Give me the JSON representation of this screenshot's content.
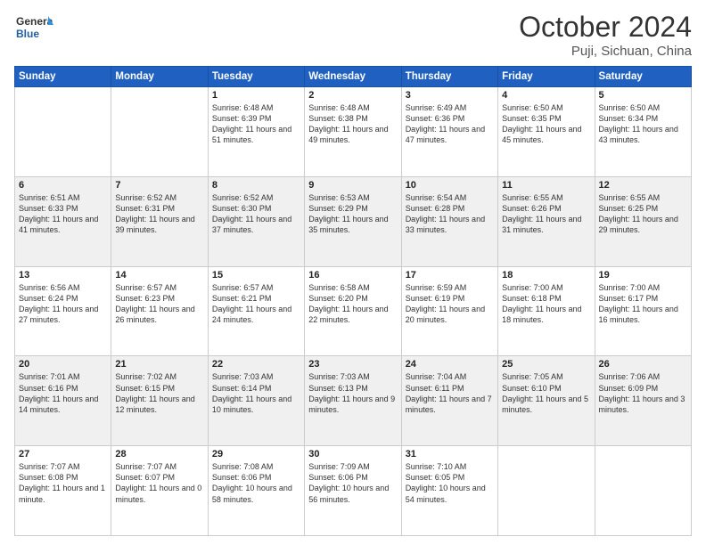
{
  "header": {
    "logo_general": "General",
    "logo_blue": "Blue",
    "month": "October 2024",
    "location": "Puji, Sichuan, China"
  },
  "weekdays": [
    "Sunday",
    "Monday",
    "Tuesday",
    "Wednesday",
    "Thursday",
    "Friday",
    "Saturday"
  ],
  "weeks": [
    [
      {
        "day": "",
        "sunrise": "",
        "sunset": "",
        "daylight": ""
      },
      {
        "day": "",
        "sunrise": "",
        "sunset": "",
        "daylight": ""
      },
      {
        "day": "1",
        "sunrise": "Sunrise: 6:48 AM",
        "sunset": "Sunset: 6:39 PM",
        "daylight": "Daylight: 11 hours and 51 minutes."
      },
      {
        "day": "2",
        "sunrise": "Sunrise: 6:48 AM",
        "sunset": "Sunset: 6:38 PM",
        "daylight": "Daylight: 11 hours and 49 minutes."
      },
      {
        "day": "3",
        "sunrise": "Sunrise: 6:49 AM",
        "sunset": "Sunset: 6:36 PM",
        "daylight": "Daylight: 11 hours and 47 minutes."
      },
      {
        "day": "4",
        "sunrise": "Sunrise: 6:50 AM",
        "sunset": "Sunset: 6:35 PM",
        "daylight": "Daylight: 11 hours and 45 minutes."
      },
      {
        "day": "5",
        "sunrise": "Sunrise: 6:50 AM",
        "sunset": "Sunset: 6:34 PM",
        "daylight": "Daylight: 11 hours and 43 minutes."
      }
    ],
    [
      {
        "day": "6",
        "sunrise": "Sunrise: 6:51 AM",
        "sunset": "Sunset: 6:33 PM",
        "daylight": "Daylight: 11 hours and 41 minutes."
      },
      {
        "day": "7",
        "sunrise": "Sunrise: 6:52 AM",
        "sunset": "Sunset: 6:31 PM",
        "daylight": "Daylight: 11 hours and 39 minutes."
      },
      {
        "day": "8",
        "sunrise": "Sunrise: 6:52 AM",
        "sunset": "Sunset: 6:30 PM",
        "daylight": "Daylight: 11 hours and 37 minutes."
      },
      {
        "day": "9",
        "sunrise": "Sunrise: 6:53 AM",
        "sunset": "Sunset: 6:29 PM",
        "daylight": "Daylight: 11 hours and 35 minutes."
      },
      {
        "day": "10",
        "sunrise": "Sunrise: 6:54 AM",
        "sunset": "Sunset: 6:28 PM",
        "daylight": "Daylight: 11 hours and 33 minutes."
      },
      {
        "day": "11",
        "sunrise": "Sunrise: 6:55 AM",
        "sunset": "Sunset: 6:26 PM",
        "daylight": "Daylight: 11 hours and 31 minutes."
      },
      {
        "day": "12",
        "sunrise": "Sunrise: 6:55 AM",
        "sunset": "Sunset: 6:25 PM",
        "daylight": "Daylight: 11 hours and 29 minutes."
      }
    ],
    [
      {
        "day": "13",
        "sunrise": "Sunrise: 6:56 AM",
        "sunset": "Sunset: 6:24 PM",
        "daylight": "Daylight: 11 hours and 27 minutes."
      },
      {
        "day": "14",
        "sunrise": "Sunrise: 6:57 AM",
        "sunset": "Sunset: 6:23 PM",
        "daylight": "Daylight: 11 hours and 26 minutes."
      },
      {
        "day": "15",
        "sunrise": "Sunrise: 6:57 AM",
        "sunset": "Sunset: 6:21 PM",
        "daylight": "Daylight: 11 hours and 24 minutes."
      },
      {
        "day": "16",
        "sunrise": "Sunrise: 6:58 AM",
        "sunset": "Sunset: 6:20 PM",
        "daylight": "Daylight: 11 hours and 22 minutes."
      },
      {
        "day": "17",
        "sunrise": "Sunrise: 6:59 AM",
        "sunset": "Sunset: 6:19 PM",
        "daylight": "Daylight: 11 hours and 20 minutes."
      },
      {
        "day": "18",
        "sunrise": "Sunrise: 7:00 AM",
        "sunset": "Sunset: 6:18 PM",
        "daylight": "Daylight: 11 hours and 18 minutes."
      },
      {
        "day": "19",
        "sunrise": "Sunrise: 7:00 AM",
        "sunset": "Sunset: 6:17 PM",
        "daylight": "Daylight: 11 hours and 16 minutes."
      }
    ],
    [
      {
        "day": "20",
        "sunrise": "Sunrise: 7:01 AM",
        "sunset": "Sunset: 6:16 PM",
        "daylight": "Daylight: 11 hours and 14 minutes."
      },
      {
        "day": "21",
        "sunrise": "Sunrise: 7:02 AM",
        "sunset": "Sunset: 6:15 PM",
        "daylight": "Daylight: 11 hours and 12 minutes."
      },
      {
        "day": "22",
        "sunrise": "Sunrise: 7:03 AM",
        "sunset": "Sunset: 6:14 PM",
        "daylight": "Daylight: 11 hours and 10 minutes."
      },
      {
        "day": "23",
        "sunrise": "Sunrise: 7:03 AM",
        "sunset": "Sunset: 6:13 PM",
        "daylight": "Daylight: 11 hours and 9 minutes."
      },
      {
        "day": "24",
        "sunrise": "Sunrise: 7:04 AM",
        "sunset": "Sunset: 6:11 PM",
        "daylight": "Daylight: 11 hours and 7 minutes."
      },
      {
        "day": "25",
        "sunrise": "Sunrise: 7:05 AM",
        "sunset": "Sunset: 6:10 PM",
        "daylight": "Daylight: 11 hours and 5 minutes."
      },
      {
        "day": "26",
        "sunrise": "Sunrise: 7:06 AM",
        "sunset": "Sunset: 6:09 PM",
        "daylight": "Daylight: 11 hours and 3 minutes."
      }
    ],
    [
      {
        "day": "27",
        "sunrise": "Sunrise: 7:07 AM",
        "sunset": "Sunset: 6:08 PM",
        "daylight": "Daylight: 11 hours and 1 minute."
      },
      {
        "day": "28",
        "sunrise": "Sunrise: 7:07 AM",
        "sunset": "Sunset: 6:07 PM",
        "daylight": "Daylight: 11 hours and 0 minutes."
      },
      {
        "day": "29",
        "sunrise": "Sunrise: 7:08 AM",
        "sunset": "Sunset: 6:06 PM",
        "daylight": "Daylight: 10 hours and 58 minutes."
      },
      {
        "day": "30",
        "sunrise": "Sunrise: 7:09 AM",
        "sunset": "Sunset: 6:06 PM",
        "daylight": "Daylight: 10 hours and 56 minutes."
      },
      {
        "day": "31",
        "sunrise": "Sunrise: 7:10 AM",
        "sunset": "Sunset: 6:05 PM",
        "daylight": "Daylight: 10 hours and 54 minutes."
      },
      {
        "day": "",
        "sunrise": "",
        "sunset": "",
        "daylight": ""
      },
      {
        "day": "",
        "sunrise": "",
        "sunset": "",
        "daylight": ""
      }
    ]
  ]
}
